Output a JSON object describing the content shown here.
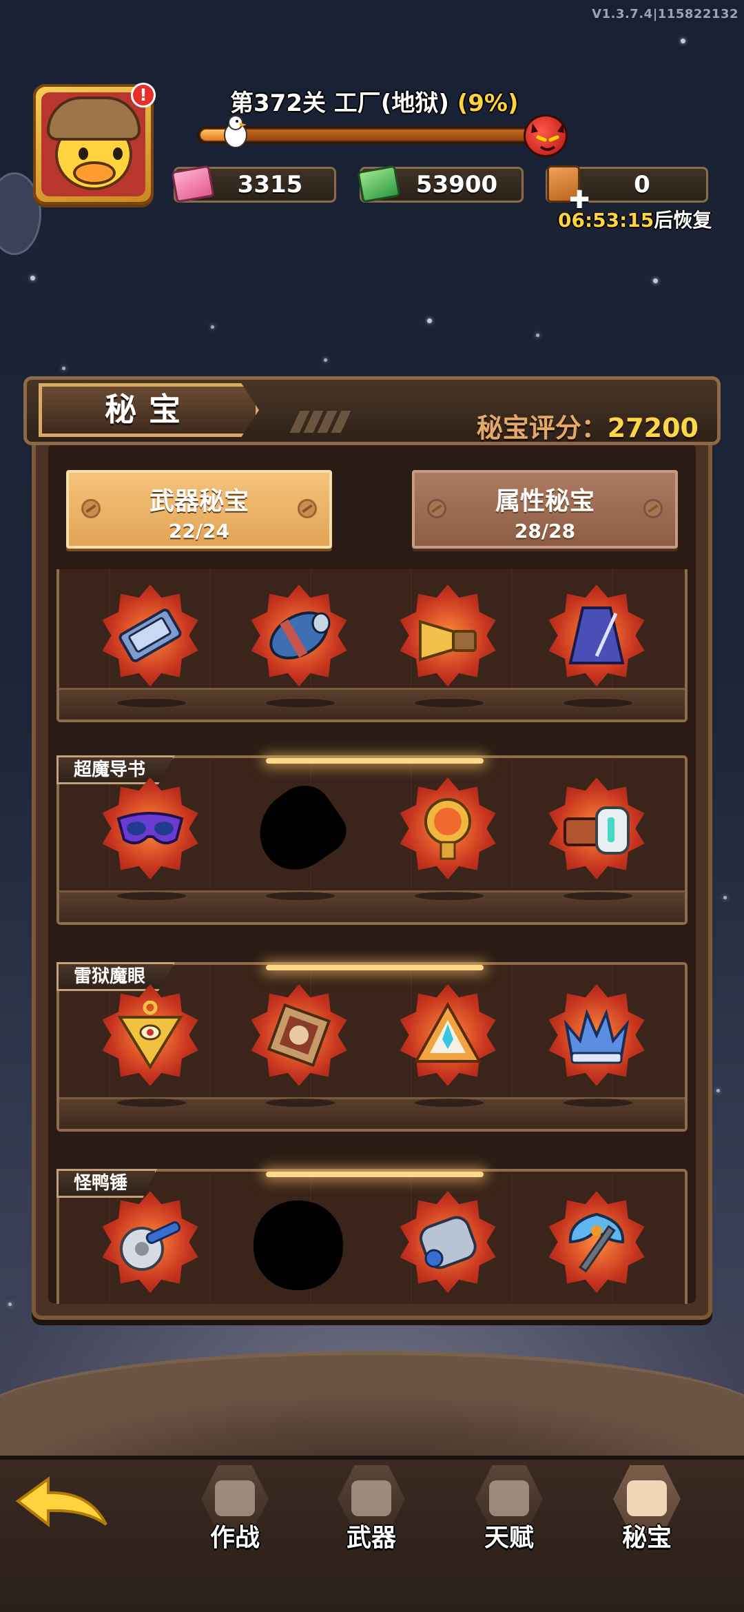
{
  "version": "V1.3.7.4|115822132",
  "profile": {
    "alert": "!"
  },
  "level": {
    "prefix": "第372关 工厂(地狱)",
    "percent_text": "(9%)",
    "progress": 0.09
  },
  "currencies": [
    {
      "name": "pink-cash",
      "value": "3315"
    },
    {
      "name": "green-cash",
      "value": "53900"
    },
    {
      "name": "stamina-card",
      "value": "0"
    }
  ],
  "timer": {
    "time": "06:53:15",
    "suffix": "后恢复"
  },
  "panel": {
    "title": "秘宝",
    "score_label": "秘宝评分：",
    "score_value": "27200"
  },
  "tabs": [
    {
      "label": "武器秘宝",
      "count": "22/24",
      "active": true
    },
    {
      "label": "属性秘宝",
      "count": "28/28",
      "active": false
    }
  ],
  "shelves": [
    {
      "label": "",
      "items": [
        "magazine",
        "bullet",
        "megaphone",
        "metronome"
      ]
    },
    {
      "label": "超魔导书",
      "items": [
        "purple-mask",
        "locked",
        "golden-amulet",
        "tape-device"
      ]
    },
    {
      "label": "雷狱魔眼",
      "items": [
        "millennium-puzzle",
        "ancient-box",
        "triangle-artifact",
        "ice-crown"
      ]
    },
    {
      "label": "怪鸭锤",
      "items": [
        "saw-wrench",
        "locked",
        "mech-fist",
        "battle-axe"
      ]
    }
  ],
  "nav": [
    {
      "label": "作战",
      "icon": "battle-icon"
    },
    {
      "label": "武器",
      "icon": "weapon-icon"
    },
    {
      "label": "天赋",
      "icon": "talent-cards-icon"
    },
    {
      "label": "秘宝",
      "icon": "treasure-icon"
    }
  ]
}
